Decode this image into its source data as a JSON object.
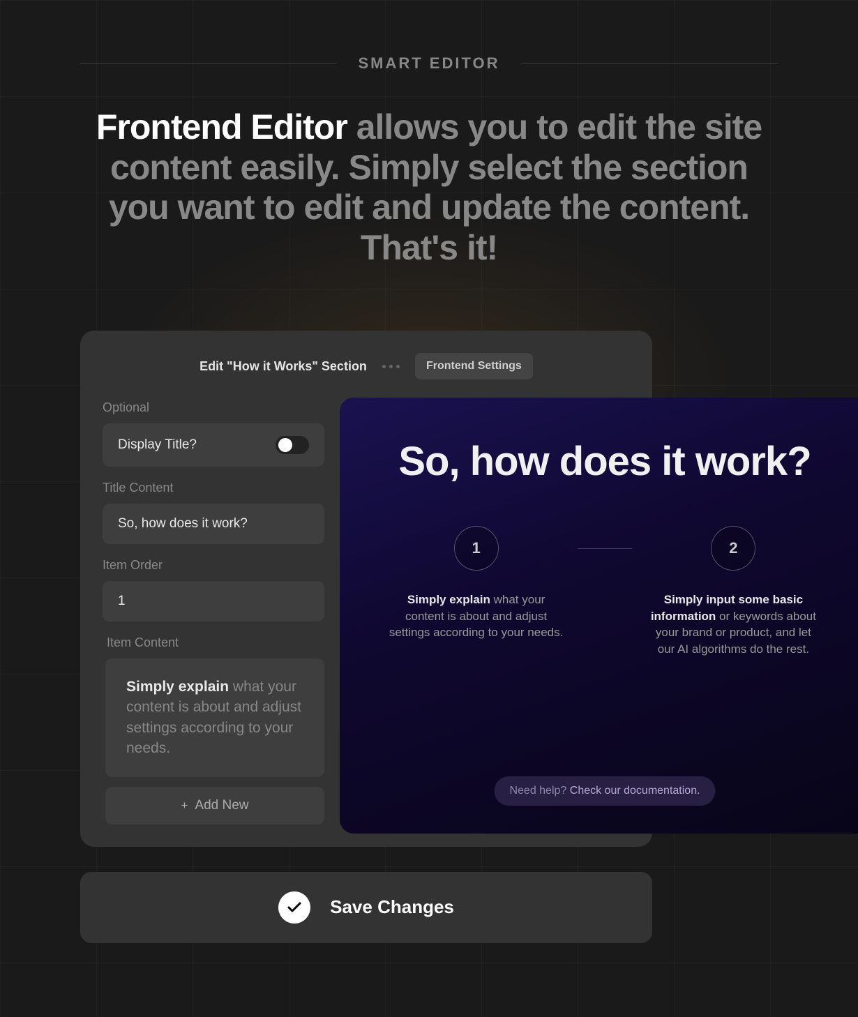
{
  "eyebrow": "SMART EDITOR",
  "hero": {
    "strong": "Frontend Editor",
    "rest": " allows you to edit the site content easily. Simply select the section you want to edit and update the content. That's it!"
  },
  "panel": {
    "edit_tab": "Edit \"How it Works\" Section",
    "settings_tab": "Frontend Settings",
    "labels": {
      "optional": "Optional",
      "display_title": "Display Title?",
      "title_content": "Title Content",
      "item_order": "Item Order",
      "item_content": "Item Content"
    },
    "values": {
      "title_content": "So, how does it work?",
      "item_order": "1",
      "item_content_strong": "Simply explain",
      "item_content_rest": " what your content is about and adjust settings according to your needs."
    },
    "add_new": "Add New"
  },
  "preview": {
    "title": "So, how does it work?",
    "steps": [
      {
        "num": "1",
        "strong": "Simply explain",
        "rest": " what your content is about and adjust settings according to your needs."
      },
      {
        "num": "2",
        "strong": "Simply input some basic information",
        "rest": " or keywords about your brand or product, and let our AI algorithms do the rest."
      }
    ],
    "help": {
      "muted": "Need help? ",
      "link": "Check our documentation."
    }
  },
  "save_label": "Save Changes"
}
